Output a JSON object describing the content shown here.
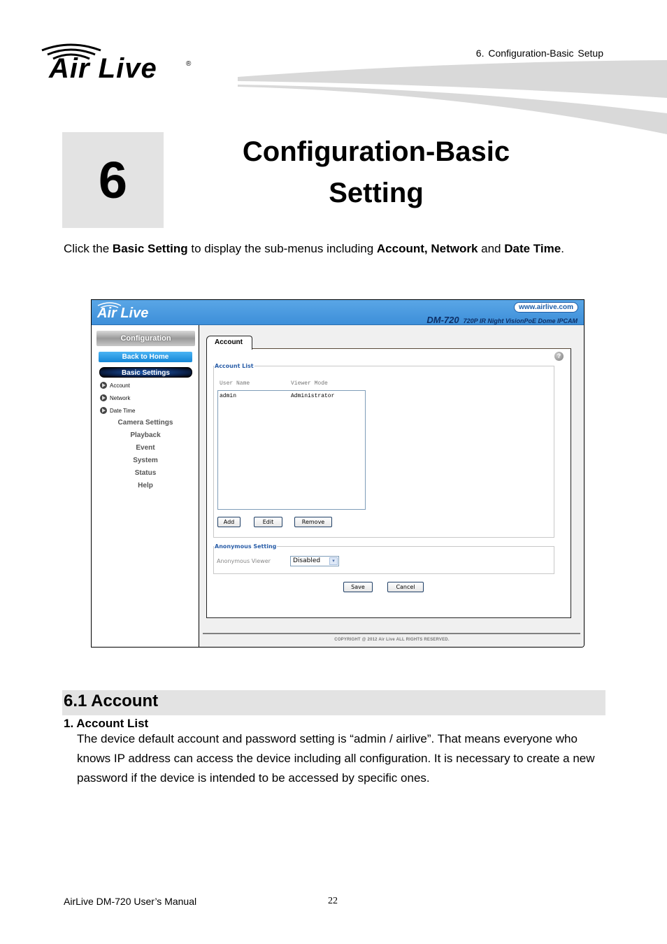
{
  "header": {
    "brand": "Air Live",
    "registered": "®",
    "running_head": "6.  Configuration-Basic  Setup"
  },
  "chapter": {
    "number": "6",
    "title_line1": "Configuration-Basic",
    "title_line2": "Setting"
  },
  "intro": {
    "t1": "Click the ",
    "b1": "Basic Setting",
    "t2": " to display the sub-menus including ",
    "b2": "Account, Network",
    "t3": " and ",
    "b3": "Date Time",
    "t4": "."
  },
  "screenshot": {
    "logo": "Air Live",
    "url": "www.airlive.com",
    "model": "DM-720",
    "model_desc": "720P IR Night VisionPoE Dome IPCAM",
    "sidebar": {
      "configuration": "Configuration",
      "back_home": "Back to Home",
      "basic_settings": "Basic Settings",
      "sub_items": [
        "Account",
        "Network",
        "Date Time"
      ],
      "links": [
        "Camera Settings",
        "Playback",
        "Event",
        "System",
        "Status",
        "Help"
      ]
    },
    "tab": "Account",
    "help_icon": "?",
    "account_list": {
      "legend": "Account List",
      "columns": [
        "User Name",
        "Viewer Mode"
      ],
      "rows": [
        {
          "user": "admin",
          "mode": "Administrator"
        }
      ],
      "buttons": {
        "add": "Add",
        "edit": "Edit",
        "remove": "Remove"
      }
    },
    "anonymous": {
      "legend": "Anonymous Setting",
      "label": "Anonymous Viewer",
      "value": "Disabled",
      "arrow": "▾"
    },
    "save": "Save",
    "cancel": "Cancel",
    "copyright": "COPYRIGHT @ 2012 Air Live ALL RIGHTS RESERVED.",
    "colors": {
      "header_blue": "#3d8fd9",
      "legend_blue": "#2a5ea8"
    }
  },
  "section": {
    "title": "6.1 Account",
    "item_head": "1.  Account List",
    "item_body": "The device default account and password setting is “admin / airlive”. That means everyone who knows IP address can access the device including all configuration. It is necessary to create a new password if the device is intended to be accessed by specific ones."
  },
  "footer": {
    "manual": "AirLive DM-720 User’s Manual",
    "page": "22"
  }
}
